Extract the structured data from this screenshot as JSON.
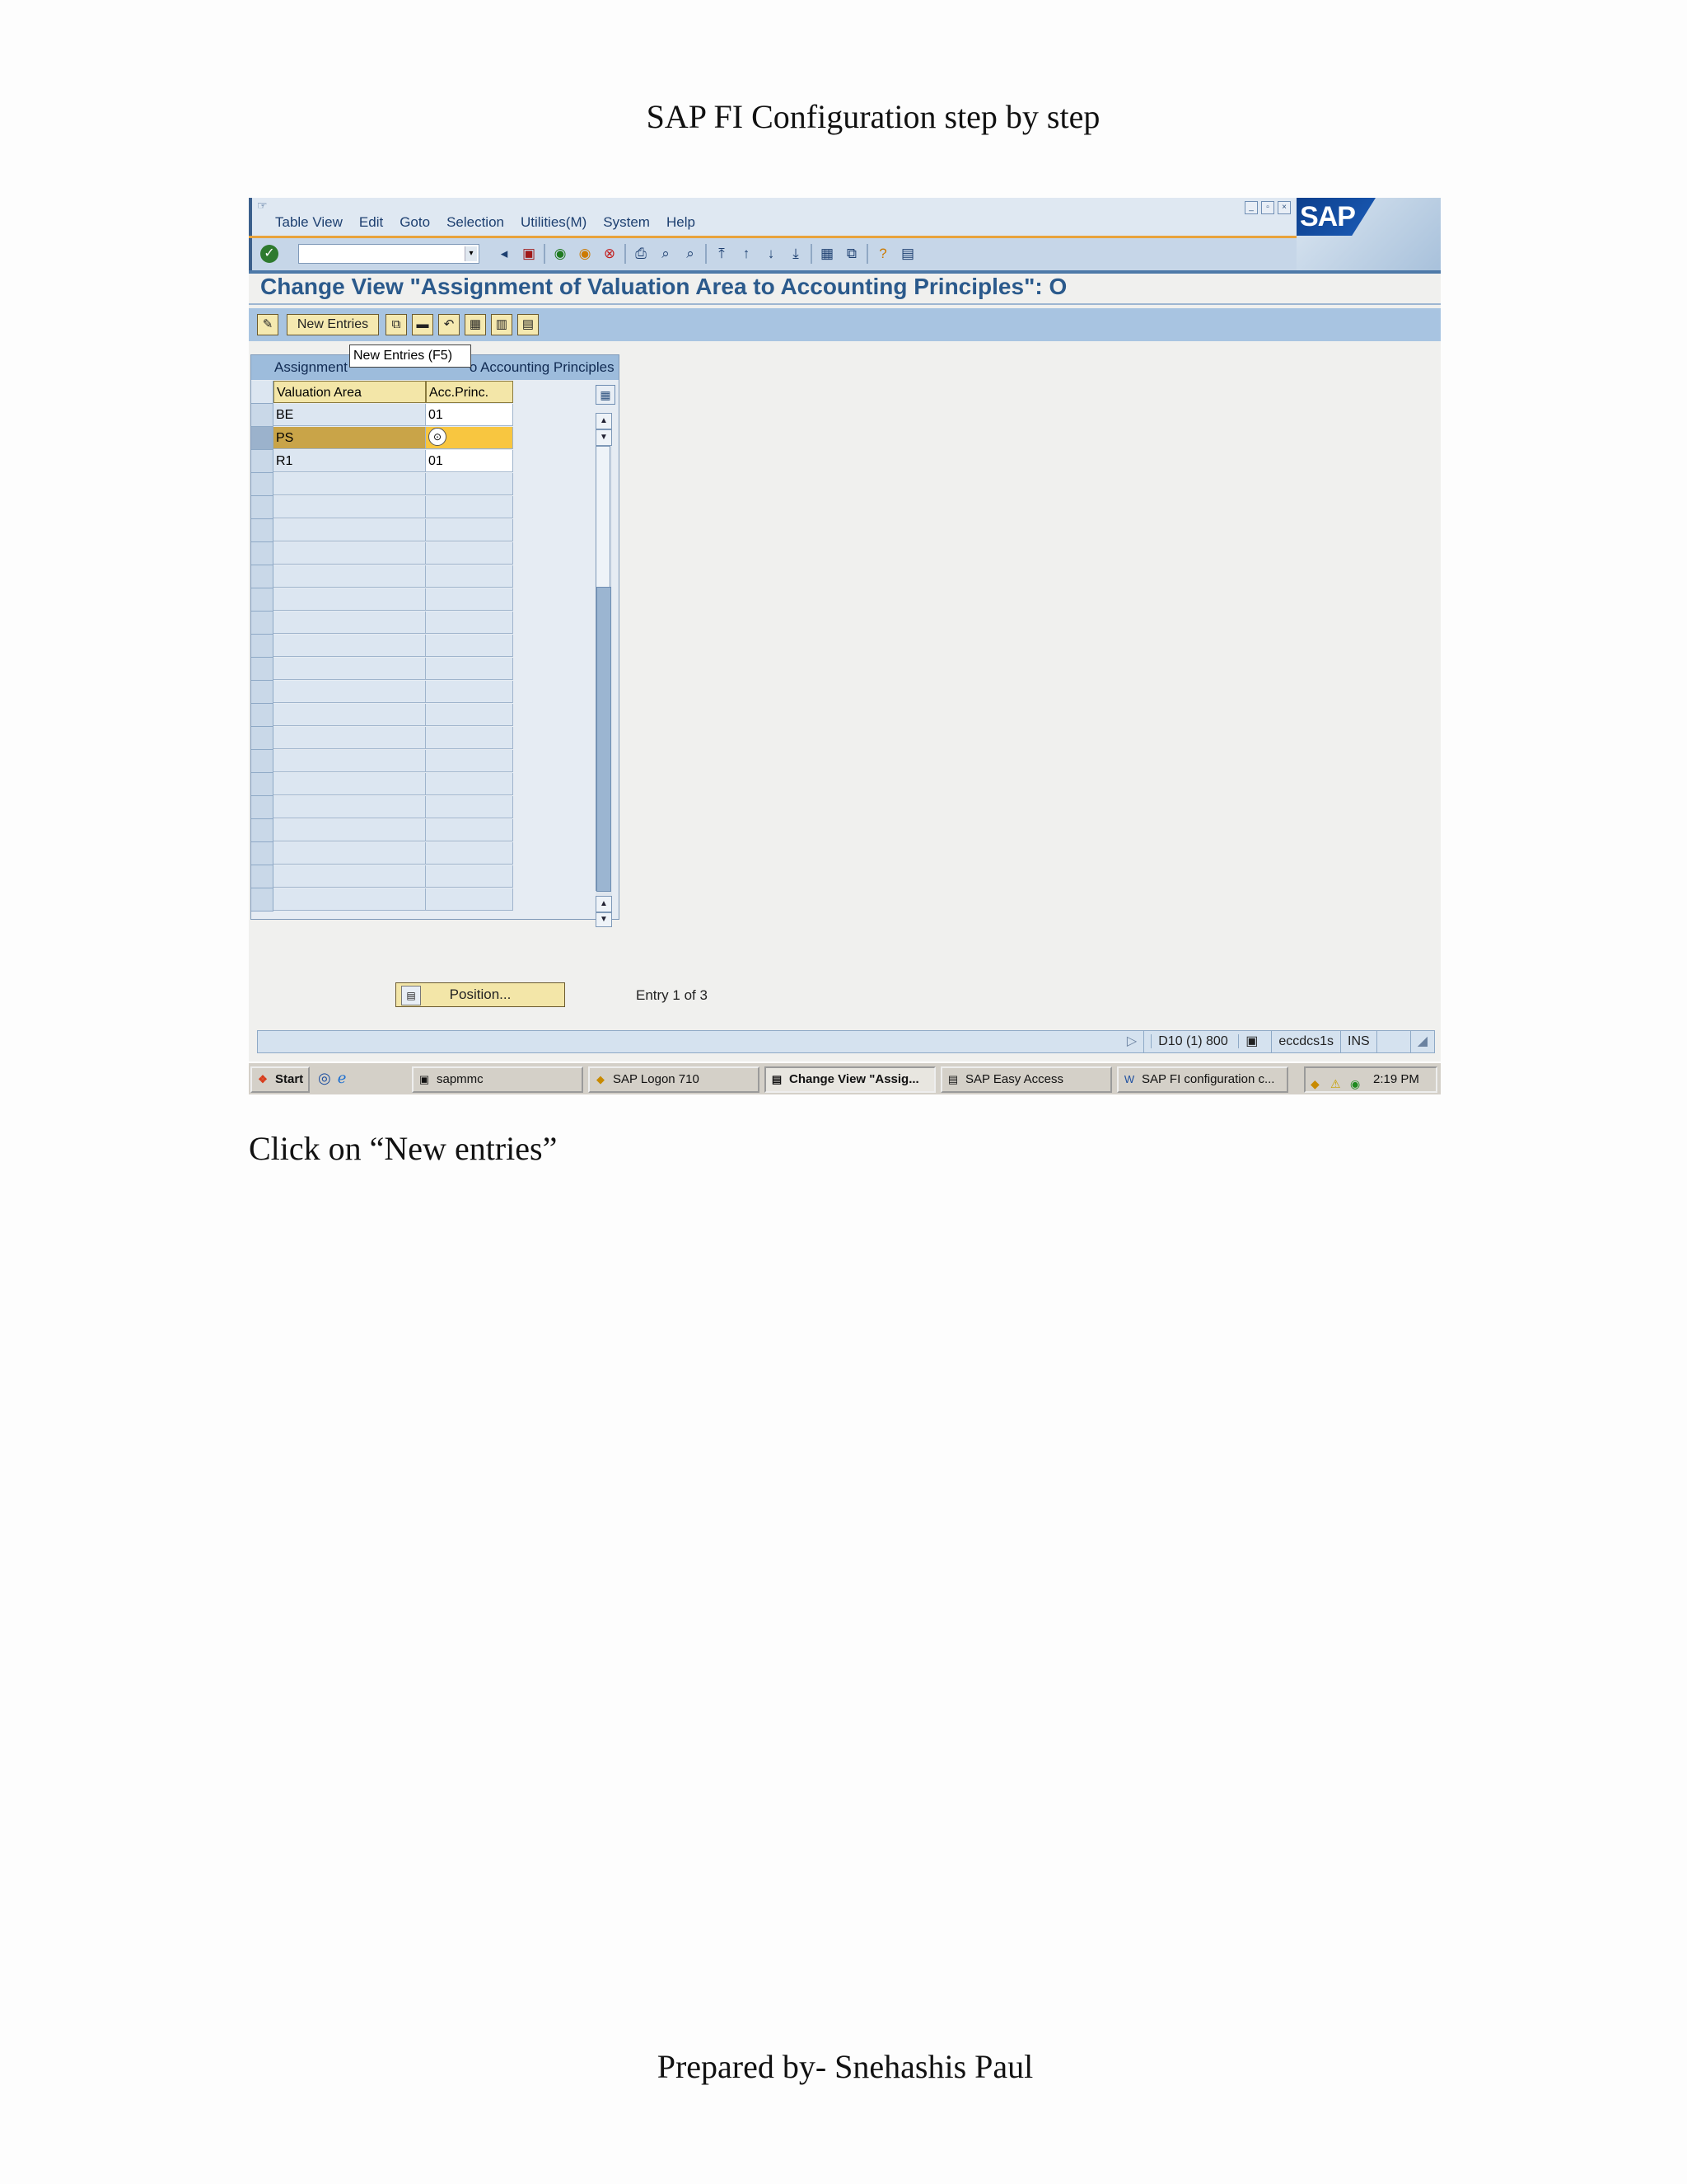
{
  "document": {
    "title": "SAP FI Configuration step by step",
    "caption": "Click on “New entries”",
    "footer": "Prepared by- Snehashis Paul"
  },
  "sap_window": {
    "menu": [
      "Table View",
      "Edit",
      "Goto",
      "Selection",
      "Utilities(M)",
      "System",
      "Help"
    ],
    "logo_text": "SAP",
    "command_field": {
      "value": ""
    },
    "page_title": "Change View \"Assignment of Valuation Area to Accounting Principles\": O",
    "app_toolbar": {
      "new_entries_label": "New Entries"
    },
    "tooltip": "New Entries   (F5)",
    "table": {
      "title_left": "Assignment",
      "title_right": "o Accounting Principles",
      "columns": [
        "Valuation Area",
        "Acc.Princ."
      ],
      "rows": [
        {
          "valuation_area": "BE",
          "acc_princ": "01"
        },
        {
          "valuation_area": "PS",
          "acc_princ": ""
        },
        {
          "valuation_area": "R1",
          "acc_princ": "01"
        }
      ],
      "empty_rows": 19
    },
    "position_button": "Position...",
    "entry_info": "Entry 1 of 3",
    "status_bar": {
      "system": "D10 (1) 800",
      "server": "eccdcs1s",
      "mode": "INS"
    }
  },
  "taskbar": {
    "start": "Start",
    "items": [
      {
        "label": "sapmmc",
        "active": false
      },
      {
        "label": "SAP Logon 710",
        "active": false
      },
      {
        "label": "Change View \"Assig...",
        "active": true
      },
      {
        "label": "SAP Easy Access",
        "active": false
      },
      {
        "label": "SAP FI configuration c...",
        "active": false
      }
    ],
    "clock": "2:19 PM"
  },
  "colors": {
    "title_blue": "#2b5a8c",
    "selected_row": "#f8c640",
    "button_yellow": "#f3e6a8"
  }
}
